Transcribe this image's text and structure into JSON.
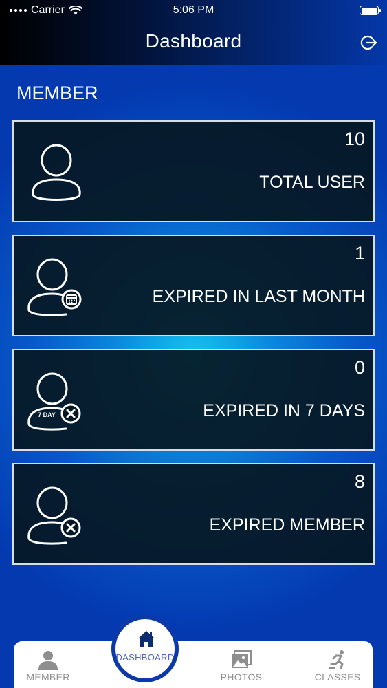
{
  "status_bar": {
    "carrier": "Carrier",
    "time": "5:06 PM"
  },
  "nav": {
    "title": "Dashboard",
    "logout_icon": "logout-icon"
  },
  "section": {
    "title": "MEMBER"
  },
  "cards": [
    {
      "count": "10",
      "label": "TOTAL USER",
      "icon": "user-icon"
    },
    {
      "count": "1",
      "label": "EXPIRED IN LAST MONTH",
      "icon": "user-calendar-icon"
    },
    {
      "count": "0",
      "label": "EXPIRED IN 7 DAYS",
      "icon": "user-7day-expired-icon",
      "icon_text": "7 DAY"
    },
    {
      "count": "8",
      "label": "EXPIRED MEMBER",
      "icon": "user-expired-icon"
    }
  ],
  "tabs": {
    "member": {
      "label": "MEMBER",
      "icon": "person-icon"
    },
    "dashboard": {
      "label": "DASHBOARD",
      "icon": "home-icon",
      "active": true
    },
    "photos": {
      "label": "PHOTOS",
      "icon": "photos-icon"
    },
    "classes": {
      "label": "CLASSES",
      "icon": "running-icon"
    }
  },
  "colors": {
    "accent": "#0b3aa8",
    "active_tab": "#4f62c6",
    "inactive_tab": "#8e8e8e",
    "card_bg": "#06182a"
  }
}
